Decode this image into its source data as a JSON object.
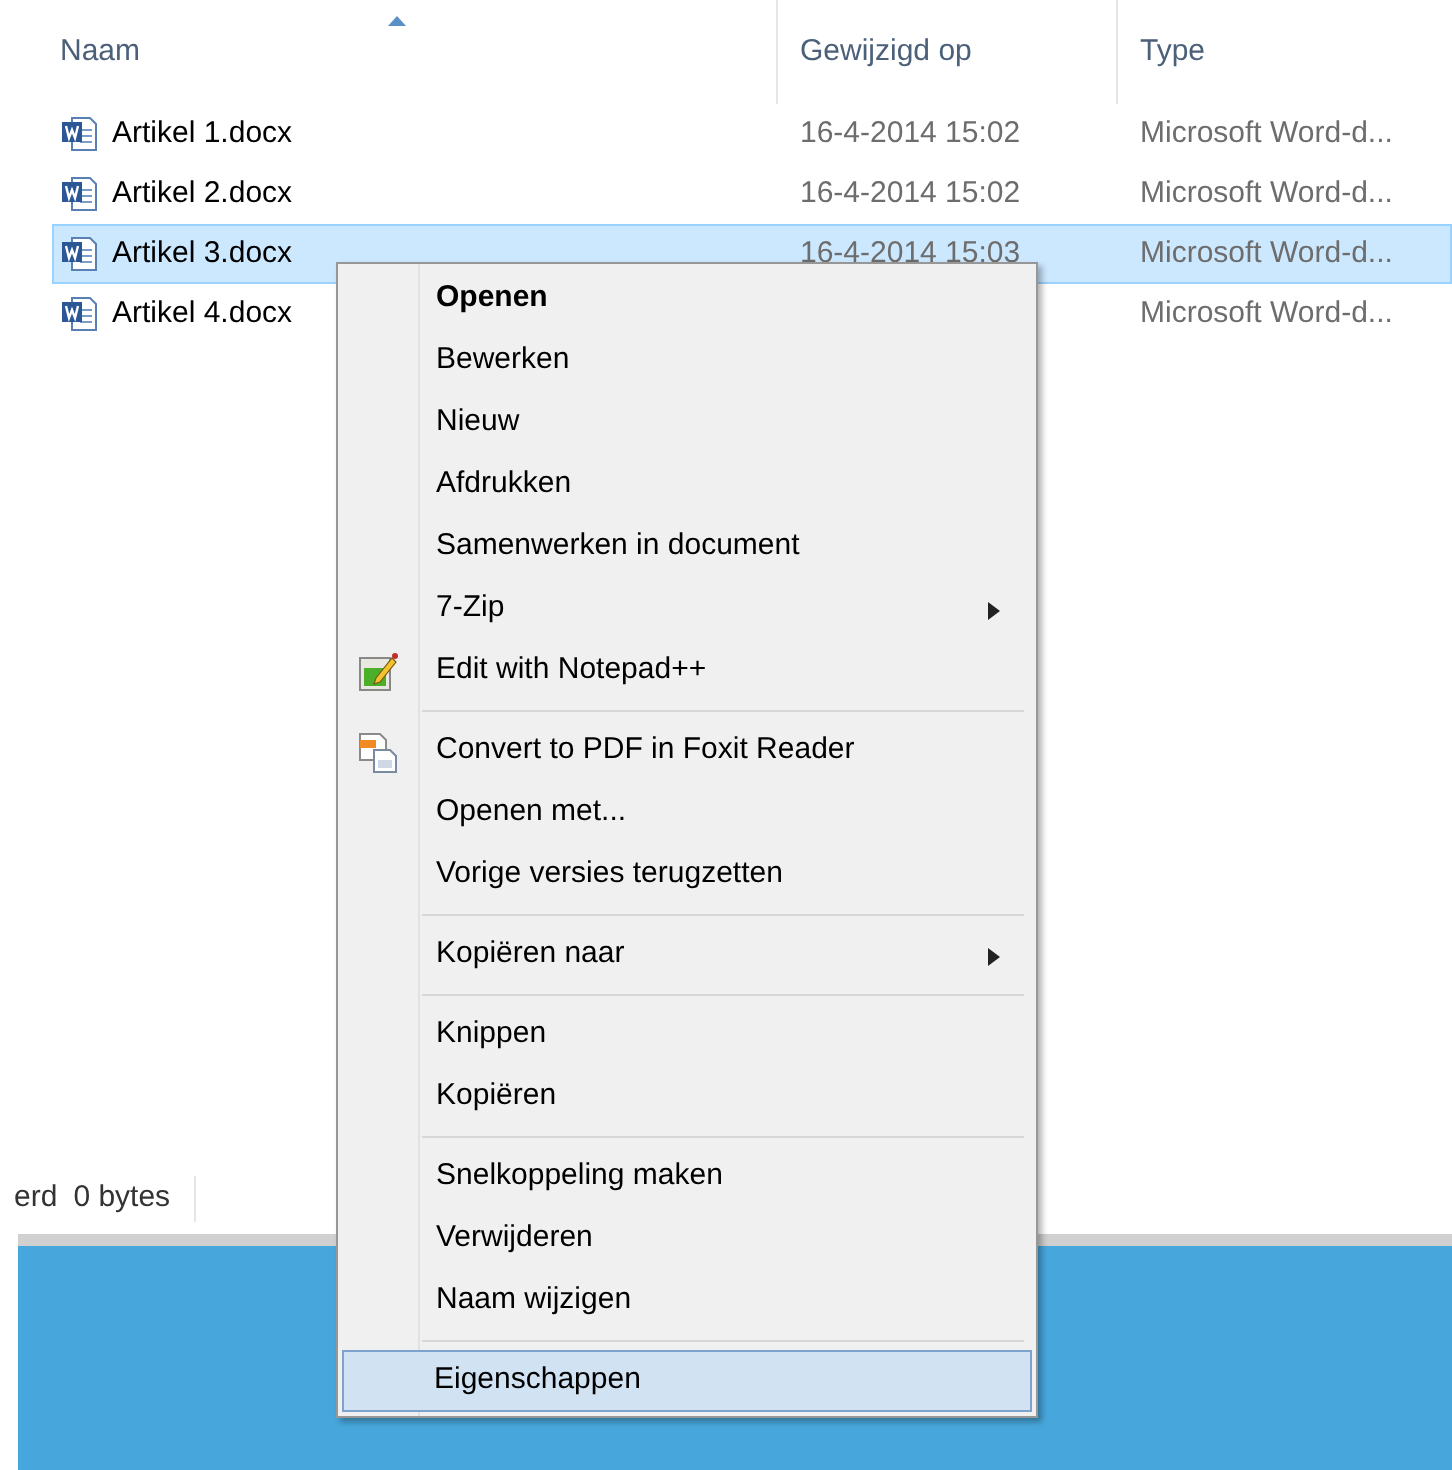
{
  "columns": [
    {
      "label": "Naam",
      "sorted": true
    },
    {
      "label": "Gewijzigd op",
      "sorted": false
    },
    {
      "label": "Type",
      "sorted": false
    }
  ],
  "files": [
    {
      "name": "Artikel 1.docx",
      "modified": "16-4-2014 15:02",
      "type": "Microsoft Word-d...",
      "selected": false
    },
    {
      "name": "Artikel 2.docx",
      "modified": "16-4-2014 15:02",
      "type": "Microsoft Word-d...",
      "selected": false
    },
    {
      "name": "Artikel 3.docx",
      "modified": "16-4-2014 15:03",
      "type": "Microsoft Word-d...",
      "selected": true
    },
    {
      "name": "Artikel 4.docx",
      "type": "Microsoft Word-d...",
      "selected": false
    }
  ],
  "status_bar": [
    "erd",
    "0 bytes"
  ],
  "context_menu": {
    "groups": [
      [
        {
          "label": "Openen",
          "kind": "text",
          "default": true,
          "selected": false
        },
        {
          "label": "Bewerken",
          "kind": "text",
          "default": false,
          "selected": false
        },
        {
          "label": "Nieuw",
          "kind": "text",
          "default": false,
          "selected": false
        },
        {
          "label": "Afdrukken",
          "kind": "text",
          "default": false,
          "selected": false
        },
        {
          "label": "Samenwerken in document",
          "kind": "text",
          "default": false,
          "selected": false
        },
        {
          "label": "7-Zip",
          "kind": "submenu",
          "default": false,
          "selected": false
        },
        {
          "label": "Edit with Notepad++",
          "kind": "notepad",
          "default": false,
          "selected": false
        }
      ],
      [
        {
          "label": "Convert to PDF in Foxit Reader",
          "kind": "pdf",
          "default": false,
          "selected": false
        },
        {
          "label": "Openen met...",
          "kind": "text",
          "default": false,
          "selected": false
        },
        {
          "label": "Vorige versies terugzetten",
          "kind": "text",
          "default": false,
          "selected": false
        }
      ],
      [
        {
          "label": "Kopiëren naar",
          "kind": "submenu",
          "default": false,
          "selected": false
        }
      ],
      [
        {
          "label": "Knippen",
          "kind": "text",
          "default": false,
          "selected": false
        },
        {
          "label": "Kopiëren",
          "kind": "text",
          "default": false,
          "selected": false
        }
      ],
      [
        {
          "label": "Snelkoppeling maken",
          "kind": "text",
          "default": false,
          "selected": false
        },
        {
          "label": "Verwijderen",
          "kind": "text",
          "default": false,
          "selected": false
        },
        {
          "label": "Naam wijzigen",
          "kind": "text",
          "default": false,
          "selected": false
        }
      ],
      [
        {
          "label": "Eigenschappen",
          "kind": "text",
          "default": false,
          "selected": true
        }
      ]
    ]
  }
}
